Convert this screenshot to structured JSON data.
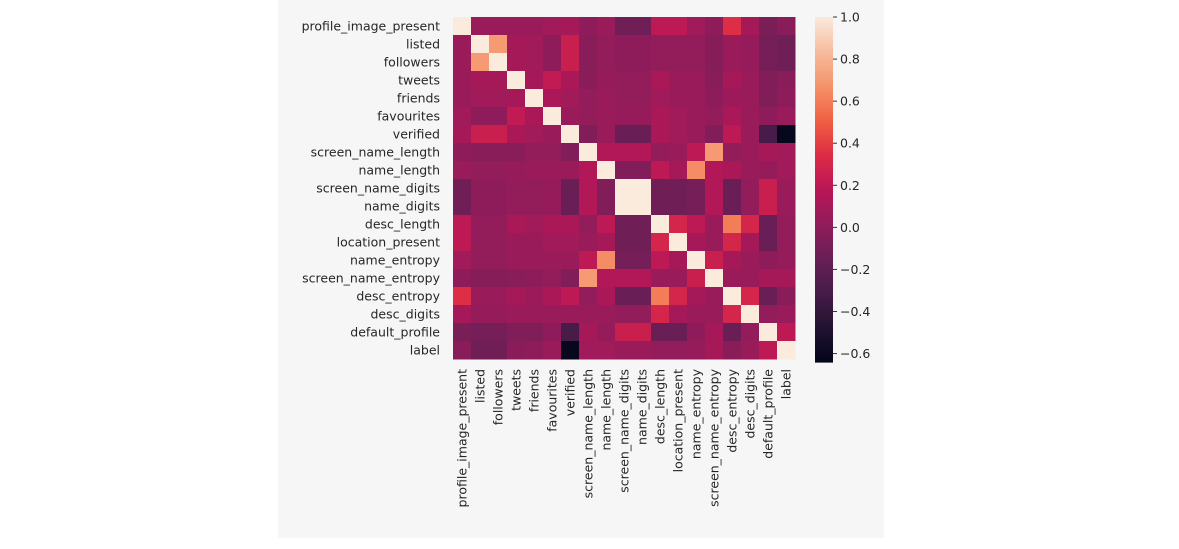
{
  "chart_data": {
    "type": "heatmap",
    "title": "",
    "xlabel": "",
    "ylabel": "",
    "labels": [
      "profile_image_present",
      "listed",
      "followers",
      "tweets",
      "friends",
      "favourites",
      "verified",
      "screen_name_length",
      "name_length",
      "screen_name_digits",
      "name_digits",
      "desc_length",
      "location_present",
      "name_entropy",
      "screen_name_entropy",
      "desc_entropy",
      "desc_digits",
      "default_profile",
      "label"
    ],
    "matrix": [
      [
        1.0,
        0.05,
        0.05,
        0.05,
        0.05,
        0.08,
        0.1,
        0.0,
        0.05,
        -0.12,
        -0.12,
        0.2,
        0.2,
        0.08,
        0.0,
        0.35,
        0.1,
        -0.08,
        -0.02
      ],
      [
        0.05,
        1.0,
        0.7,
        0.1,
        0.08,
        0.0,
        0.25,
        -0.02,
        0.02,
        0.0,
        0.0,
        0.02,
        0.02,
        0.02,
        -0.03,
        0.05,
        0.03,
        -0.1,
        -0.12
      ],
      [
        0.05,
        0.7,
        1.0,
        0.1,
        0.08,
        0.0,
        0.25,
        -0.02,
        0.02,
        0.0,
        0.0,
        0.02,
        0.02,
        0.02,
        -0.03,
        0.05,
        0.03,
        -0.1,
        -0.12
      ],
      [
        0.05,
        0.1,
        0.1,
        1.0,
        0.1,
        0.22,
        0.12,
        -0.02,
        0.03,
        0.02,
        0.02,
        0.12,
        0.05,
        0.05,
        -0.02,
        0.1,
        0.05,
        -0.05,
        -0.02
      ],
      [
        0.05,
        0.08,
        0.08,
        0.1,
        1.0,
        0.12,
        0.08,
        0.02,
        0.05,
        0.02,
        0.02,
        0.08,
        0.05,
        0.05,
        0.0,
        0.06,
        0.05,
        -0.05,
        0.0
      ],
      [
        0.08,
        0.0,
        0.0,
        0.22,
        0.12,
        1.0,
        0.05,
        0.02,
        0.05,
        0.03,
        0.03,
        0.12,
        0.08,
        0.05,
        0.02,
        0.12,
        0.05,
        0.0,
        0.05
      ],
      [
        0.1,
        0.25,
        0.25,
        0.12,
        0.08,
        0.05,
        1.0,
        -0.05,
        0.05,
        -0.15,
        -0.15,
        0.12,
        0.08,
        0.05,
        -0.05,
        0.2,
        0.05,
        -0.3,
        -0.62
      ],
      [
        0.0,
        -0.02,
        -0.02,
        -0.02,
        0.02,
        0.02,
        -0.05,
        1.0,
        0.15,
        0.15,
        0.15,
        0.02,
        0.05,
        0.2,
        0.7,
        0.02,
        0.05,
        0.1,
        0.08
      ],
      [
        0.05,
        0.02,
        0.02,
        0.03,
        0.05,
        0.05,
        0.05,
        0.15,
        1.0,
        -0.05,
        -0.05,
        0.2,
        0.1,
        0.65,
        0.15,
        0.12,
        0.05,
        0.03,
        0.08
      ],
      [
        -0.12,
        0.0,
        0.0,
        0.02,
        0.02,
        0.03,
        -0.15,
        0.15,
        -0.05,
        1.0,
        1.0,
        -0.12,
        -0.12,
        -0.1,
        0.15,
        -0.15,
        0.02,
        0.25,
        0.05
      ],
      [
        -0.12,
        0.0,
        0.0,
        0.02,
        0.02,
        0.03,
        -0.15,
        0.15,
        -0.05,
        1.0,
        1.0,
        -0.12,
        -0.12,
        -0.1,
        0.15,
        -0.15,
        0.02,
        0.25,
        0.05
      ],
      [
        0.2,
        0.02,
        0.02,
        0.12,
        0.08,
        0.12,
        0.12,
        0.02,
        0.2,
        -0.12,
        -0.12,
        1.0,
        0.3,
        0.2,
        0.05,
        0.6,
        0.3,
        -0.15,
        0.02
      ],
      [
        0.2,
        0.02,
        0.02,
        0.05,
        0.05,
        0.08,
        0.08,
        0.05,
        0.1,
        -0.12,
        -0.12,
        0.3,
        1.0,
        0.1,
        0.05,
        0.3,
        0.1,
        -0.15,
        0.02
      ],
      [
        0.08,
        0.02,
        0.02,
        0.05,
        0.05,
        0.05,
        0.05,
        0.2,
        0.65,
        -0.1,
        -0.1,
        0.2,
        0.1,
        1.0,
        0.25,
        0.1,
        0.05,
        0.0,
        0.03
      ],
      [
        0.0,
        -0.03,
        -0.03,
        -0.02,
        0.0,
        0.02,
        -0.05,
        0.7,
        0.15,
        0.15,
        0.15,
        0.05,
        0.05,
        0.25,
        1.0,
        0.05,
        0.05,
        0.1,
        0.1
      ],
      [
        0.35,
        0.05,
        0.05,
        0.1,
        0.06,
        0.12,
        0.2,
        0.02,
        0.12,
        -0.15,
        -0.15,
        0.6,
        0.3,
        0.1,
        0.05,
        1.0,
        0.3,
        -0.15,
        -0.02
      ],
      [
        0.1,
        0.03,
        0.03,
        0.05,
        0.05,
        0.05,
        0.05,
        0.05,
        0.05,
        0.02,
        0.02,
        0.3,
        0.1,
        0.05,
        0.05,
        0.3,
        1.0,
        0.02,
        0.05
      ],
      [
        -0.08,
        -0.1,
        -0.1,
        -0.05,
        -0.05,
        0.0,
        -0.3,
        0.1,
        0.03,
        0.25,
        0.25,
        -0.15,
        -0.15,
        0.0,
        0.1,
        -0.15,
        0.02,
        1.0,
        0.2
      ],
      [
        -0.02,
        -0.12,
        -0.12,
        -0.02,
        0.0,
        0.05,
        -0.62,
        0.08,
        0.08,
        0.05,
        0.05,
        0.02,
        0.02,
        0.03,
        0.1,
        -0.02,
        0.05,
        0.2,
        1.0
      ]
    ],
    "colormap": "rocket",
    "vmin": -0.64,
    "vmax": 1.0,
    "colorbar_ticks": [
      "1.0",
      "0.8",
      "0.6",
      "0.4",
      "0.2",
      "0.0",
      "−0.2",
      "−0.4",
      "−0.6"
    ],
    "colorbar_tick_values": [
      1.0,
      0.8,
      0.6,
      0.4,
      0.2,
      0.0,
      -0.2,
      -0.4,
      -0.6
    ],
    "legend": "colorbar-right",
    "grid": false
  }
}
